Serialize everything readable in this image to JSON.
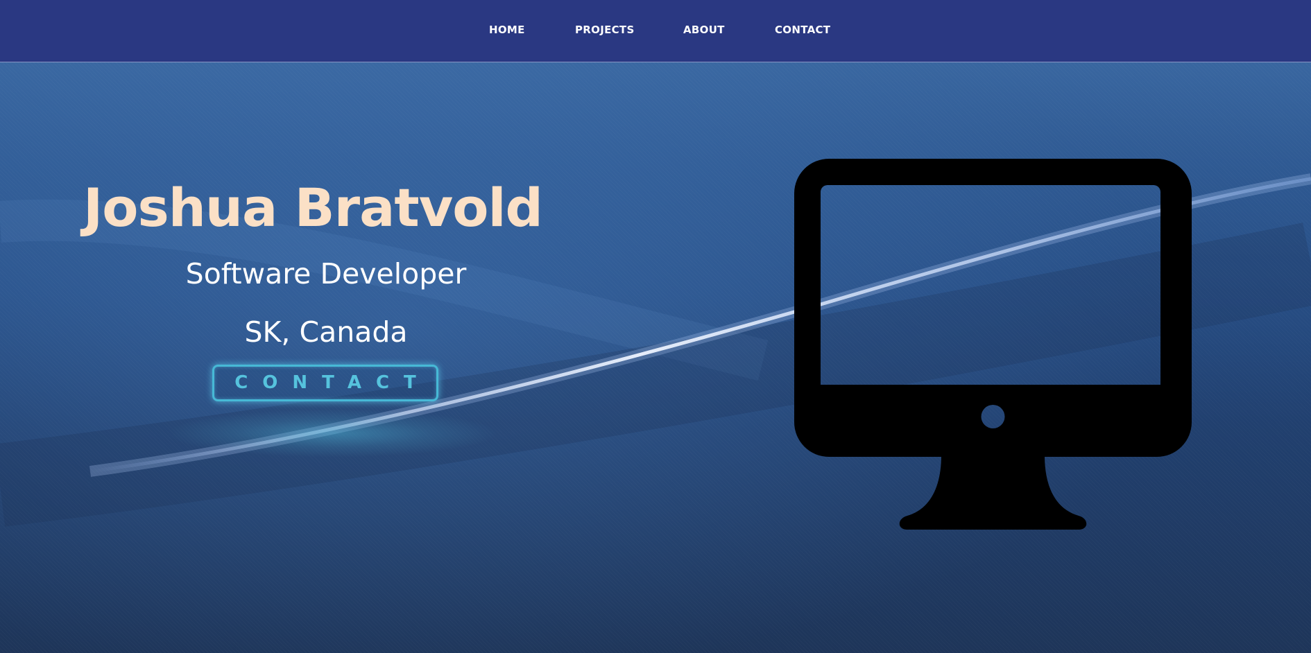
{
  "nav": {
    "items": [
      {
        "label": "HOME"
      },
      {
        "label": "PROJECTS"
      },
      {
        "label": "ABOUT"
      },
      {
        "label": "CONTACT"
      }
    ]
  },
  "hero": {
    "name": "Joshua Bratvold",
    "role": "Software Developer",
    "location": "SK, Canada",
    "contact_button": "CONTACT"
  },
  "icons": {
    "hero_image": "monitor-icon"
  },
  "colors": {
    "nav_bg": "#2a3882",
    "name": "#fbe0c6",
    "accent": "#47b9d6"
  }
}
